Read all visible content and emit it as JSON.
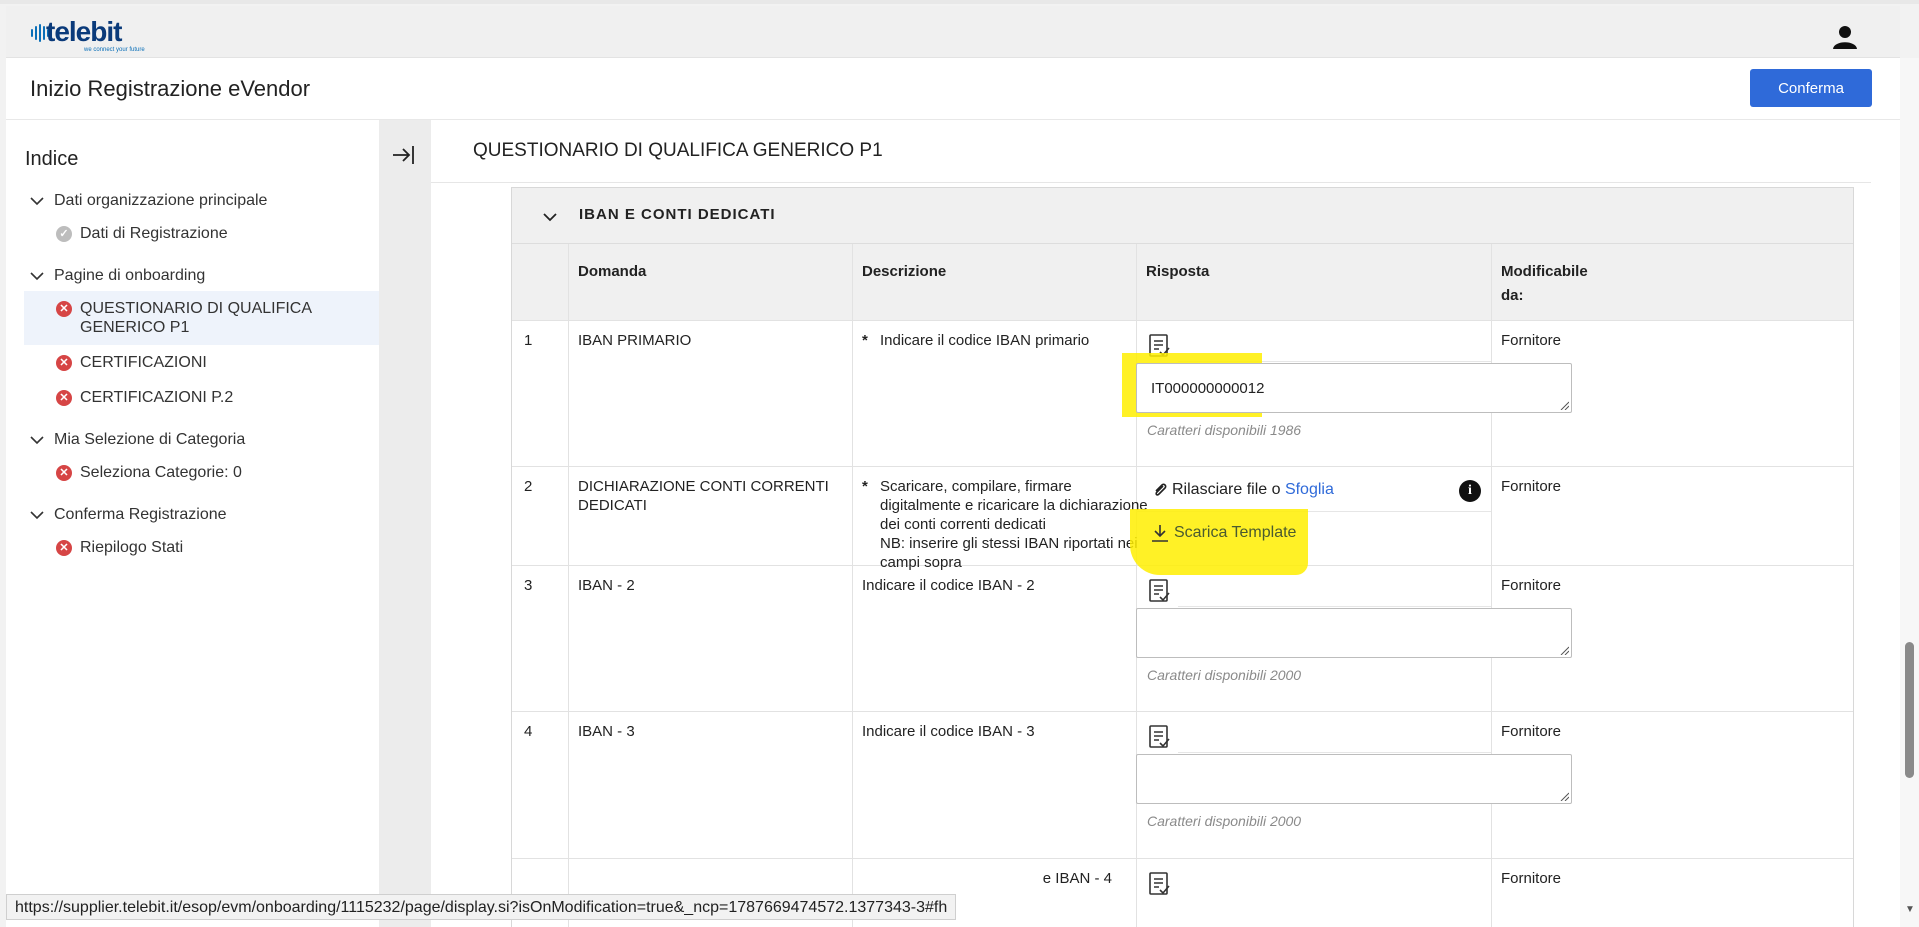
{
  "app": {
    "logo_text": "telebit",
    "logo_tagline": "we connect your future",
    "title": "Inizio Registrazione eVendor",
    "confirm_label": "Conferma"
  },
  "sidebar": {
    "title": "Indice",
    "groups": [
      {
        "label": "Dati organizzazione principale",
        "items": [
          {
            "label": "Dati di Registrazione",
            "status": "ok"
          }
        ]
      },
      {
        "label": "Pagine di onboarding",
        "items": [
          {
            "label": "QUESTIONARIO DI QUALIFICA GENERICO P1",
            "status": "error",
            "active": true
          },
          {
            "label": "CERTIFICAZIONI",
            "status": "error"
          },
          {
            "label": "CERTIFICAZIONI P.2",
            "status": "error"
          }
        ]
      },
      {
        "label": "Mia Selezione di Categoria",
        "items": [
          {
            "label": "Seleziona Categorie: 0",
            "status": "error"
          }
        ]
      },
      {
        "label": "Conferma Registrazione",
        "items": [
          {
            "label": "Riepilogo Stati",
            "status": "error"
          }
        ]
      }
    ]
  },
  "main": {
    "section_title": "QUESTIONARIO DI QUALIFICA GENERICO P1",
    "panel_title": "IBAN E CONTI DEDICATI",
    "columns": [
      "Domanda",
      "Descrizione",
      "Risposta",
      "Modificabile da:"
    ],
    "rows": [
      {
        "num": "1",
        "question": "IBAN PRIMARIO",
        "required": true,
        "description": "Indicare il codice IBAN primario",
        "value": "IT000000000012",
        "chars": "Caratteri disponibili 1986",
        "editable_by": "Fornitore"
      },
      {
        "num": "2",
        "question": "DICHIARAZIONE CONTI CORRENTI DEDICATI",
        "required": true,
        "description": "Scaricare, compilare, firmare digitalmente e ricaricare la dichiarazione dei conti correnti dedicati",
        "description_note": "NB: inserire gli stessi IBAN riportati nei campi sopra",
        "upload_text": "Rilasciare file o ",
        "upload_link": "Sfoglia",
        "template_label": "Scarica Template",
        "editable_by": "Fornitore"
      },
      {
        "num": "3",
        "question": "IBAN - 2",
        "required": false,
        "description": "Indicare il codice IBAN - 2",
        "value": "",
        "chars": "Caratteri disponibili 2000",
        "editable_by": "Fornitore"
      },
      {
        "num": "4",
        "question": "IBAN - 3",
        "required": false,
        "description": "Indicare il codice IBAN - 3",
        "value": "",
        "chars": "Caratteri disponibili 2000",
        "editable_by": "Fornitore"
      },
      {
        "num": "",
        "question": "",
        "required": false,
        "description": "e IBAN - 4",
        "editable_by": "Fornitore"
      }
    ]
  },
  "status_bar": {
    "url": "https://supplier.telebit.it/esop/evm/onboarding/1115232/page/display.si?isOnModification=true&_ncp=1787669474572.1377343-3#fh"
  },
  "icons": {
    "user": "user-icon",
    "collapse": "collapse-sidebar-icon",
    "doc": "document-list-icon",
    "attach": "paperclip-icon",
    "download": "download-icon",
    "info": "info-icon"
  },
  "colors": {
    "accent": "#2f6ad9",
    "error": "#d64545",
    "highlight": "#ffee00"
  }
}
